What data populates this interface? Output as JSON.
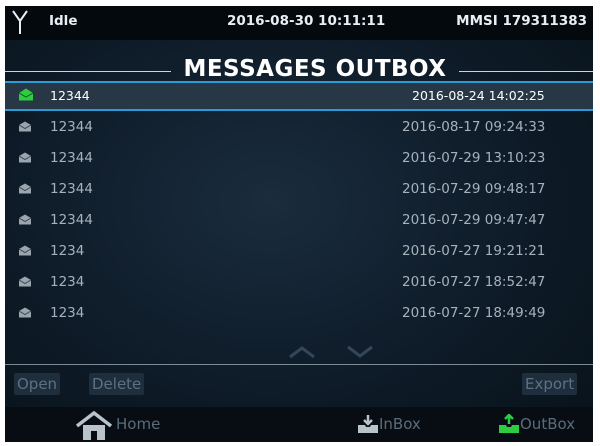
{
  "status": {
    "state": "Idle",
    "datetime": "2016-08-30 10:11:11",
    "mmsi": "MMSI 179311383"
  },
  "screen": {
    "title": "MESSAGES OUTBOX"
  },
  "messages": [
    {
      "name": "12344",
      "date": "2016-08-24 14:02:25",
      "selected": true
    },
    {
      "name": "12344",
      "date": "2016-08-17 09:24:33"
    },
    {
      "name": "12344",
      "date": "2016-07-29 13:10:23"
    },
    {
      "name": "12344",
      "date": "2016-07-29 09:48:17"
    },
    {
      "name": "12344",
      "date": "2016-07-29 09:47:47"
    },
    {
      "name": "1234",
      "date": "2016-07-27 19:21:21"
    },
    {
      "name": "1234",
      "date": "2016-07-27 18:52:47"
    },
    {
      "name": "1234",
      "date": "2016-07-27 18:49:49"
    }
  ],
  "actions": {
    "open": "Open",
    "delete": "Delete",
    "export": "Export"
  },
  "nav": {
    "home": "Home",
    "inbox": "InBox",
    "outbox": "OutBox"
  },
  "colors": {
    "accent": "#2b9bd5",
    "active_icon": "#2ecc40"
  }
}
